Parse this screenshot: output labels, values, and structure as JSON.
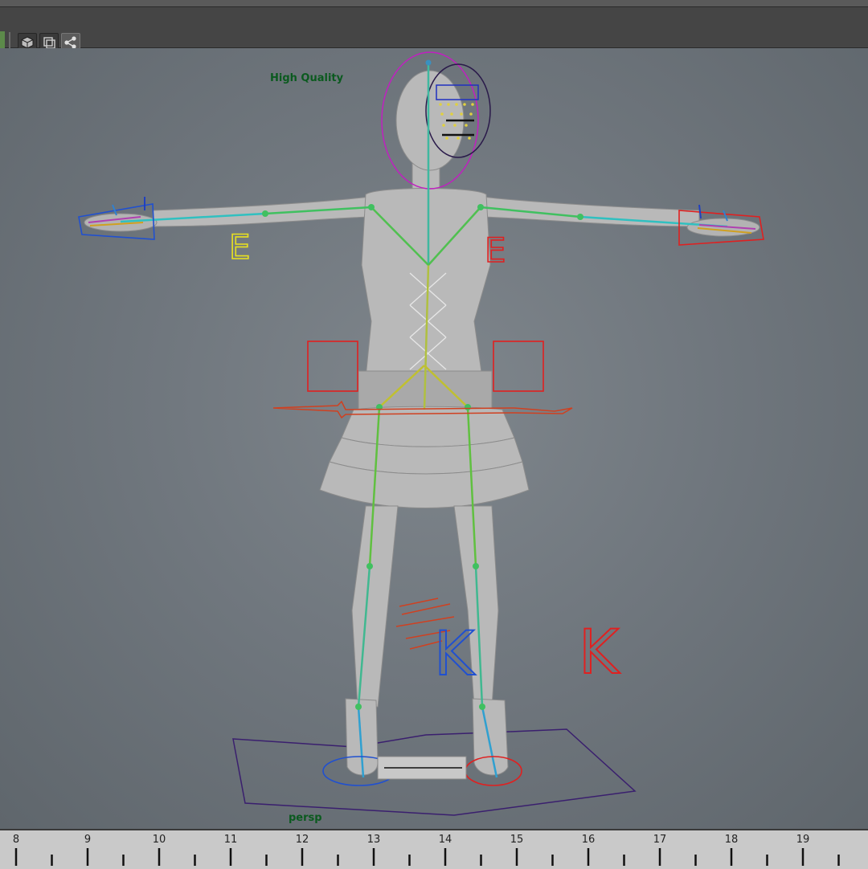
{
  "toolbar": {
    "buttons": [
      {
        "name": "cube-icon",
        "active": false
      },
      {
        "name": "wireframe-icon",
        "active": false
      },
      {
        "name": "node-graph-icon",
        "active": true
      }
    ]
  },
  "viewport": {
    "quality_label": "High Quality",
    "camera_label": "persp",
    "control_letters": {
      "left_elbow": "E",
      "right_elbow": "E",
      "left_knee": "K",
      "right_knee": "K"
    }
  },
  "timeline": {
    "ticks": [
      "8",
      "9",
      "10",
      "11",
      "12",
      "13",
      "14",
      "15",
      "16",
      "17",
      "18",
      "19"
    ]
  },
  "colors": {
    "viewport_bg": "#70777e",
    "hud_green": "#0b5a1f",
    "ctrl_left": "#2050d0",
    "ctrl_right": "#e02020",
    "ctrl_elbow_left": "#e8e020",
    "head_ctrl": "#c020c0",
    "joint": "#40c060"
  }
}
